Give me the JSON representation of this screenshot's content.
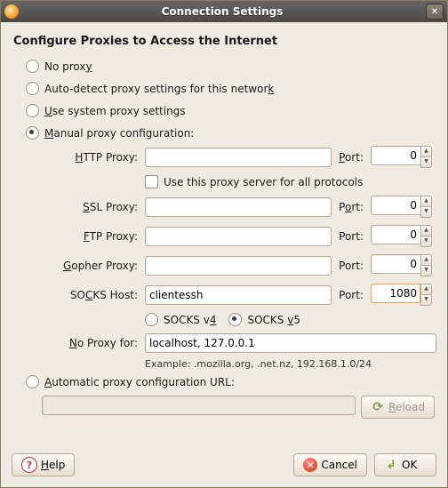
{
  "window": {
    "title": "Connection Settings"
  },
  "heading": "Configure Proxies to Access the Internet",
  "radios": {
    "no_proxy": {
      "label": "No prox",
      "accel": "y"
    },
    "auto_detect": {
      "label": "Auto-detect proxy settings for this networ",
      "accel": "k"
    },
    "system": {
      "label_before": "",
      "accel": "U",
      "label_after": "se system proxy settings"
    },
    "manual": {
      "label_before": "",
      "accel": "M",
      "label_after": "anual proxy configuration:"
    },
    "auto_url": {
      "label_before": "",
      "accel": "A",
      "label_after": "utomatic proxy configuration URL:"
    },
    "selected": "manual"
  },
  "labels": {
    "http": {
      "accel": "H",
      "rest": "TTP Proxy:"
    },
    "ssl": {
      "accel": "S",
      "rest": "SL Proxy:"
    },
    "ftp": {
      "accel": "F",
      "rest": "TP Proxy:"
    },
    "gopher": {
      "accel": "G",
      "rest": "opher Proxy:"
    },
    "socks": {
      "pre": "SO",
      "accel": "C",
      "rest": "KS Host:"
    },
    "no_for": {
      "accel": "N",
      "rest": "o Proxy for:"
    },
    "port": {
      "accel": "P",
      "rest": "ort:"
    },
    "port2": {
      "pre": "P",
      "accel": "o",
      "rest": "rt:"
    },
    "port_plain": "Port:",
    "use_all": "Use this proxy server for all protocols"
  },
  "fields": {
    "http": {
      "host": "",
      "port": "0"
    },
    "ssl": {
      "host": "",
      "port": "0"
    },
    "ftp": {
      "host": "",
      "port": "0"
    },
    "gopher": {
      "host": "",
      "port": "0"
    },
    "socks": {
      "host": "clientessh",
      "port": "1080"
    },
    "no_proxy_for": "localhost, 127.0.0.1",
    "example": "Example: .mozilla.org, .net.nz, 192.168.1.0/24",
    "auto_url": ""
  },
  "socks_version": {
    "v4": {
      "pre": "SOCKS v",
      "accel": "4"
    },
    "v5": {
      "pre": "SOCKS ",
      "accel": "v",
      "rest": "5"
    },
    "selected": "v5"
  },
  "buttons": {
    "reload": {
      "accel": "R",
      "rest": "eload"
    },
    "help": {
      "accel": "H",
      "rest": "elp"
    },
    "cancel": "Cancel",
    "ok": "OK"
  }
}
